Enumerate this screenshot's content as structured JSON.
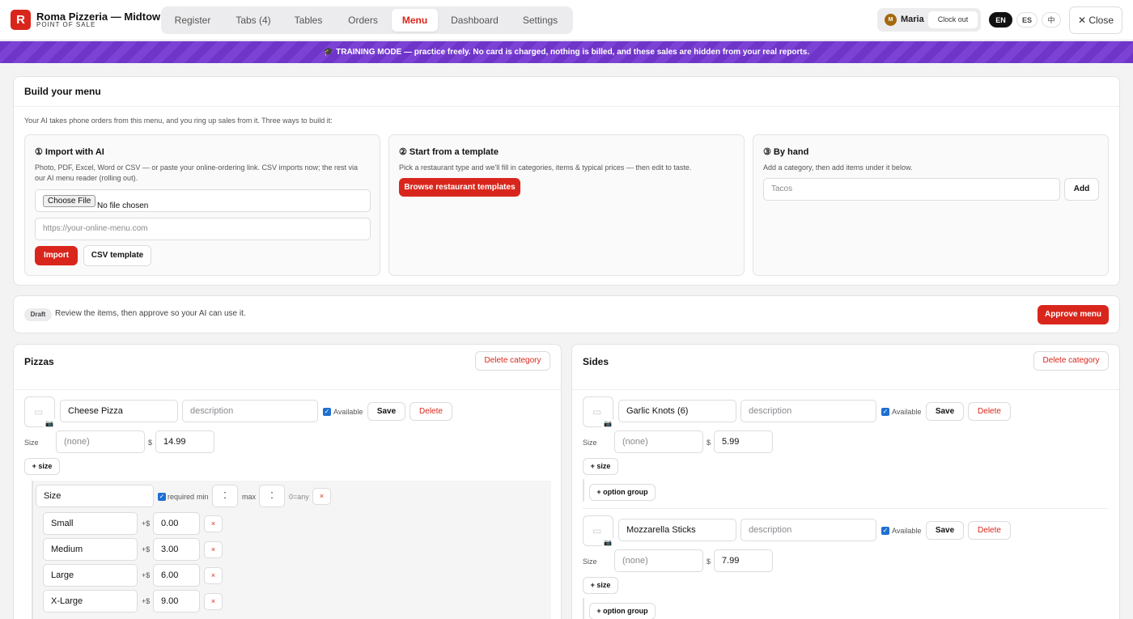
{
  "header": {
    "logo_letter": "R",
    "title": "Roma Pizzeria — Midtown",
    "subtitle": "POINT OF SALE",
    "tabs": [
      {
        "label": "Register"
      },
      {
        "label": "Tabs (4)"
      },
      {
        "label": "Tables"
      },
      {
        "label": "Orders"
      },
      {
        "label": "Menu"
      },
      {
        "label": "Dashboard"
      },
      {
        "label": "Settings"
      }
    ],
    "active_tab": "Menu",
    "user": {
      "initial": "M",
      "name": "Maria",
      "clock_out": "Clock out"
    },
    "languages": [
      "EN",
      "ES",
      "中"
    ],
    "active_language": "EN",
    "close_label": "✕ Close"
  },
  "banner": {
    "text": "🎓 TRAINING MODE — practice freely. No card is charged, nothing is billed, and these sales are hidden from your real reports."
  },
  "build": {
    "title": "Build your menu",
    "intro": "Your AI takes phone orders from this menu, and you ring up sales from it. Three ways to build it:",
    "import_ai": {
      "title": "① Import with AI",
      "desc": "Photo, PDF, Excel, Word or CSV — or paste your online-ordering link. CSV imports now; the rest via our AI menu reader (rolling out).",
      "file_button": "Choose File",
      "file_status": "No file chosen",
      "url_placeholder": "https://your-online-menu.com",
      "import_label": "Import",
      "csv_label": "CSV template"
    },
    "template": {
      "title": "② Start from a template",
      "desc": "Pick a restaurant type and we'll fill in categories, items & typical prices — then edit to taste.",
      "button": "Browse restaurant templates"
    },
    "by_hand": {
      "title": "③ By hand",
      "desc": "Add a category, then add items under it below.",
      "placeholder": "Tacos",
      "add_label": "Add"
    }
  },
  "draft": {
    "badge": "Draft",
    "text": "Review the items, then approve so your AI can use it.",
    "approve_label": "Approve menu"
  },
  "labels": {
    "delete_category": "Delete category",
    "available": "Available",
    "save": "Save",
    "delete": "Delete",
    "size": "Size",
    "currency": "$",
    "add_size": "+ size",
    "add_option_group": "+ option group",
    "description_placeholder": "description",
    "size_placeholder": "(none)",
    "required": "required",
    "min": "min",
    "max": "max",
    "zero_any": "0=any",
    "plus_currency": "+$",
    "remove": "×"
  },
  "categories": [
    {
      "name": "Pizzas",
      "items": [
        {
          "name": "Cheese Pizza",
          "price": "14.99",
          "available": true,
          "option_group": {
            "name": "Size",
            "required": true,
            "options": [
              {
                "name": "Small",
                "price": "0.00"
              },
              {
                "name": "Medium",
                "price": "3.00"
              },
              {
                "name": "Large",
                "price": "6.00"
              },
              {
                "name": "X-Large",
                "price": "9.00"
              }
            ]
          }
        }
      ]
    },
    {
      "name": "Sides",
      "items": [
        {
          "name": "Garlic Knots (6)",
          "price": "5.99",
          "available": true
        },
        {
          "name": "Mozzarella Sticks",
          "price": "7.99",
          "available": true
        }
      ]
    }
  ],
  "colors": {
    "brand": "#d9261c",
    "banner": "#7c42d4",
    "checkbox": "#1f6fd1"
  }
}
